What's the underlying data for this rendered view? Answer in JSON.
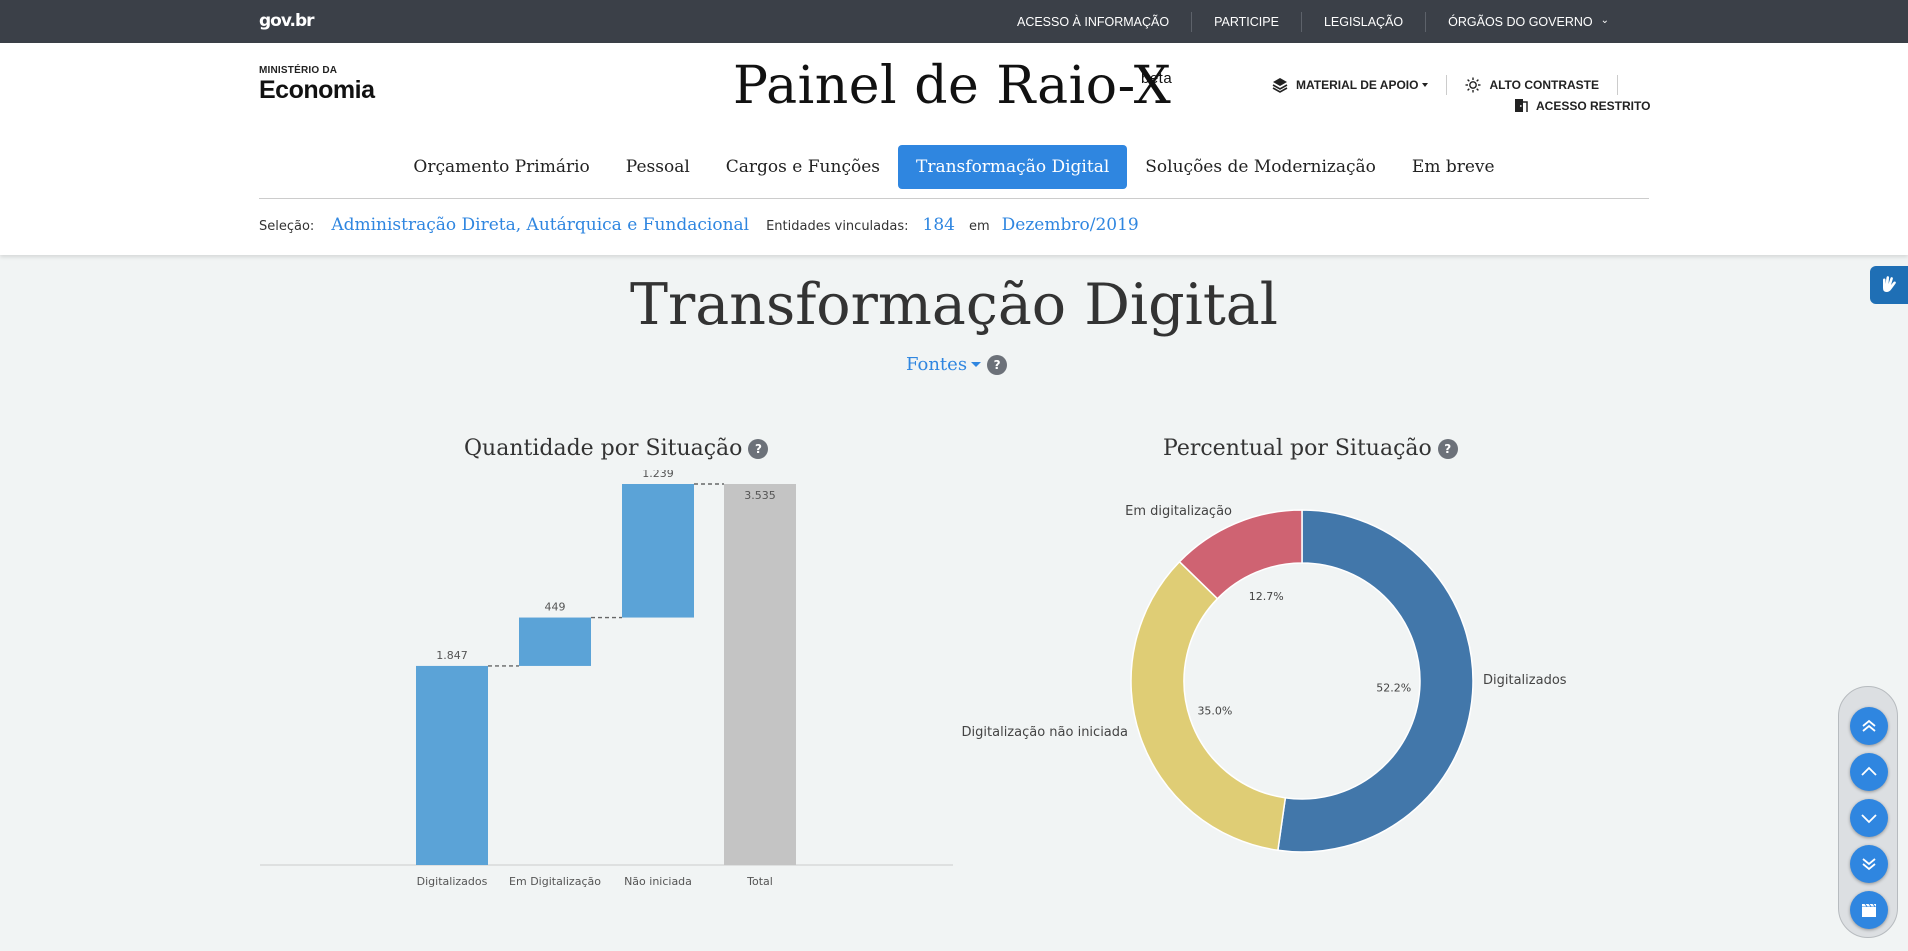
{
  "topbar": {
    "logo": "gov.br",
    "links": [
      "ACESSO À INFORMAÇÃO",
      "PARTICIPE",
      "LEGISLAÇÃO",
      "ÓRGÃOS DO GOVERNO"
    ]
  },
  "header": {
    "ministry_small": "MINISTÉRIO DA",
    "ministry_big": "Economia",
    "brand_title": "Painel de Raio-X",
    "brand_badge": "beta",
    "material": "MATERIAL DE APOIO",
    "contrast": "ALTO CONTRASTE",
    "restricted": "ACESSO RESTRITO"
  },
  "nav": {
    "tabs": [
      "Orçamento Primário",
      "Pessoal",
      "Cargos e Funções",
      "Transformação Digital",
      "Soluções de Modernização",
      "Em breve"
    ],
    "active": "Transformação Digital"
  },
  "selection": {
    "label": "Seleção:",
    "value": "Administração Direta, Autárquica e Fundacional",
    "entities_label": "Entidades vinculadas:",
    "entities_value": "184",
    "in_label": "em",
    "date": "Dezembro/2019"
  },
  "main": {
    "title": "Transformação Digital",
    "sources": "Fontes",
    "help": "?"
  },
  "colors": {
    "accent": "#2f86e0",
    "bar": "#5ba3d7",
    "total_bar": "#c4c4c4",
    "donut_blue": "#4277aa",
    "donut_yellow": "#dfcd75",
    "donut_red": "#cf6372"
  },
  "chart_data": [
    {
      "type": "bar",
      "title": "Quantidade por Situação",
      "subtype": "waterfall",
      "categories": [
        "Digitalizados",
        "Em Digitalização",
        "Não iniciada",
        "Total"
      ],
      "values": [
        1847,
        449,
        1239,
        3535
      ],
      "labels": [
        "1.847",
        "449",
        "1.239",
        "3.535"
      ],
      "ylim": [
        0,
        3535
      ]
    },
    {
      "type": "pie",
      "title": "Percentual por Situação",
      "subtype": "donut",
      "slices": [
        {
          "name": "Digitalizados",
          "value": 52.2,
          "label": "52.2%"
        },
        {
          "name": "Digitalização não iniciada",
          "value": 35.0,
          "label": "35.0%"
        },
        {
          "name": "Em digitalização",
          "value": 12.7,
          "label": "12.7%"
        }
      ]
    }
  ]
}
